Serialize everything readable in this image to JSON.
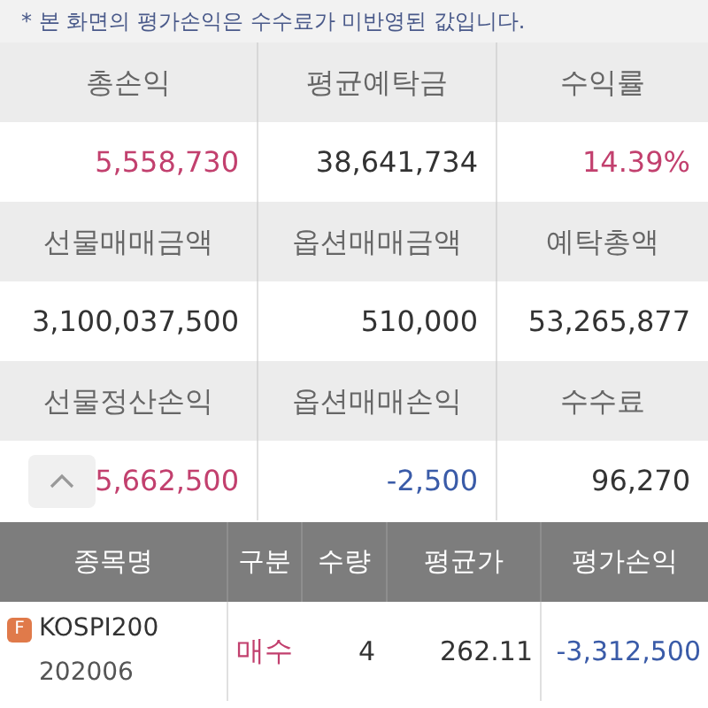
{
  "notice": "* 본 화면의 평가손익은 수수료가 미반영된 값입니다.",
  "summary": [
    [
      {
        "label": "총손익",
        "value": "5,558,730",
        "color": "#c2406e"
      },
      {
        "label": "평균예탁금",
        "value": "38,641,734",
        "color": "#333333"
      },
      {
        "label": "수익률",
        "value": "14.39%",
        "color": "#c2406e"
      }
    ],
    [
      {
        "label": "선물매매금액",
        "value": "3,100,037,500",
        "color": "#333333"
      },
      {
        "label": "옵션매매금액",
        "value": "510,000",
        "color": "#333333"
      },
      {
        "label": "예탁총액",
        "value": "53,265,877",
        "color": "#333333"
      }
    ],
    [
      {
        "label": "선물정산손익",
        "value": "5,662,500",
        "color": "#c2406e"
      },
      {
        "label": "옵션매매손익",
        "value": "-2,500",
        "color": "#3a5ba8"
      },
      {
        "label": "수수료",
        "value": "96,270",
        "color": "#333333"
      }
    ]
  ],
  "table": {
    "columns": [
      "종목명",
      "구분",
      "수량",
      "평균가",
      "평가손익"
    ],
    "rows": [
      {
        "badge": "F",
        "name": "KOSPI200",
        "code": "202006",
        "side": {
          "text": "매수",
          "color": "#c2406e"
        },
        "quantity": "4",
        "avg_price": "262.11",
        "pnl": {
          "text": "-3,312,500",
          "color": "#3a5ba8"
        }
      }
    ]
  }
}
